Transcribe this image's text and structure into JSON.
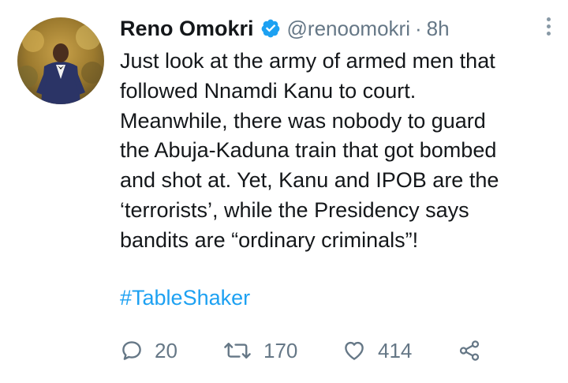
{
  "author": {
    "name": "Reno Omokri",
    "handle": "@renoomokri",
    "separator": "·",
    "time": "8h"
  },
  "tweet": {
    "lines": [
      "Just look at the army of armed men that",
      "followed Nnamdi Kanu to court.",
      "Meanwhile, there was nobody to guard",
      "the Abuja-Kaduna train that got bombed",
      "and shot at. Yet, Kanu and IPOB are the",
      "‘terrorists’, while the Presidency says",
      "bandits are “ordinary criminals”!"
    ],
    "hashtag": "#TableShaker"
  },
  "actions": {
    "replies": "20",
    "retweets": "170",
    "likes": "414"
  },
  "colors": {
    "accent": "#1da1f2",
    "muted": "#657786",
    "text": "#14171a"
  },
  "icons": [
    "verified-badge-icon",
    "more-options-icon",
    "reply-icon",
    "retweet-icon",
    "like-icon",
    "share-icon"
  ]
}
